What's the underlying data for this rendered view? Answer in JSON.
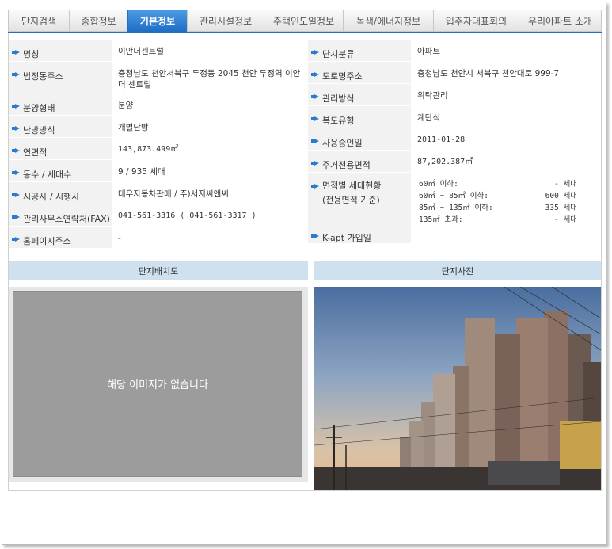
{
  "tabs": [
    {
      "label": "단지검색",
      "active": false
    },
    {
      "label": "종합정보",
      "active": false
    },
    {
      "label": "기본정보",
      "active": true
    },
    {
      "label": "관리시설정보",
      "active": false
    },
    {
      "label": "주택인도일정보",
      "active": false
    },
    {
      "label": "녹색/에너지정보",
      "active": false
    },
    {
      "label": "입주자대표회의",
      "active": false
    },
    {
      "label": "우리아파트 소개",
      "active": false
    }
  ],
  "left_info": [
    {
      "label": "명칭",
      "value": "이안더센트럴"
    },
    {
      "label": "법정동주소",
      "value": "충청남도 천안서북구 두정동 2045 천안 두정역 이안더 센트럴"
    },
    {
      "label": "분양형태",
      "value": "분양"
    },
    {
      "label": "난방방식",
      "value": "개별난방"
    },
    {
      "label": "연면적",
      "value": "143,873.499㎡"
    },
    {
      "label": "동수 / 세대수",
      "value": "9 / 935 세대"
    },
    {
      "label": "시공사 / 시행사",
      "value": "대우자동차판매 / 주)서지씨앤씨"
    },
    {
      "label": "관리사무소연락처(FAX)",
      "value": "041-561-3316 ( 041-561-3317 )"
    },
    {
      "label": "홈페이지주소",
      "value": "-"
    }
  ],
  "right_info": {
    "rows_before": [
      {
        "label": "단지분류",
        "value": "아파트"
      },
      {
        "label": "도로명주소",
        "value": "충청남도 천안시 서북구 천안대로 999-7"
      },
      {
        "label": "관리방식",
        "value": "위탁관리"
      },
      {
        "label": "복도유형",
        "value": "계단식"
      },
      {
        "label": "사용승인일",
        "value": "2011-01-28"
      },
      {
        "label": "주거전용면적",
        "value": "87,202.387㎡"
      }
    ],
    "area_label_line1": "면적별 세대현황",
    "area_label_line2": "(전용면적 기준)",
    "area_rows": [
      {
        "range": "60㎡ 이하:",
        "count": "- 세대"
      },
      {
        "range": "60㎡ ~ 85㎡ 이하:",
        "count": "600 세대"
      },
      {
        "range": "85㎡ ~ 135㎡ 이하:",
        "count": "335 세대"
      },
      {
        "range": "135㎡ 초과:",
        "count": "- 세대"
      }
    ],
    "kapt_label": "K-apt 가입일",
    "kapt_value": ""
  },
  "panels": {
    "layout_title": "단지배치도",
    "photo_title": "단지사진",
    "no_image_text": "해당 이미지가 없습니다"
  },
  "colors": {
    "active_tab": "#1f6fc6",
    "label_bg": "#f2f2f2",
    "panel_head_bg": "#cfe0ef",
    "bullet": "#2a7bd0"
  }
}
